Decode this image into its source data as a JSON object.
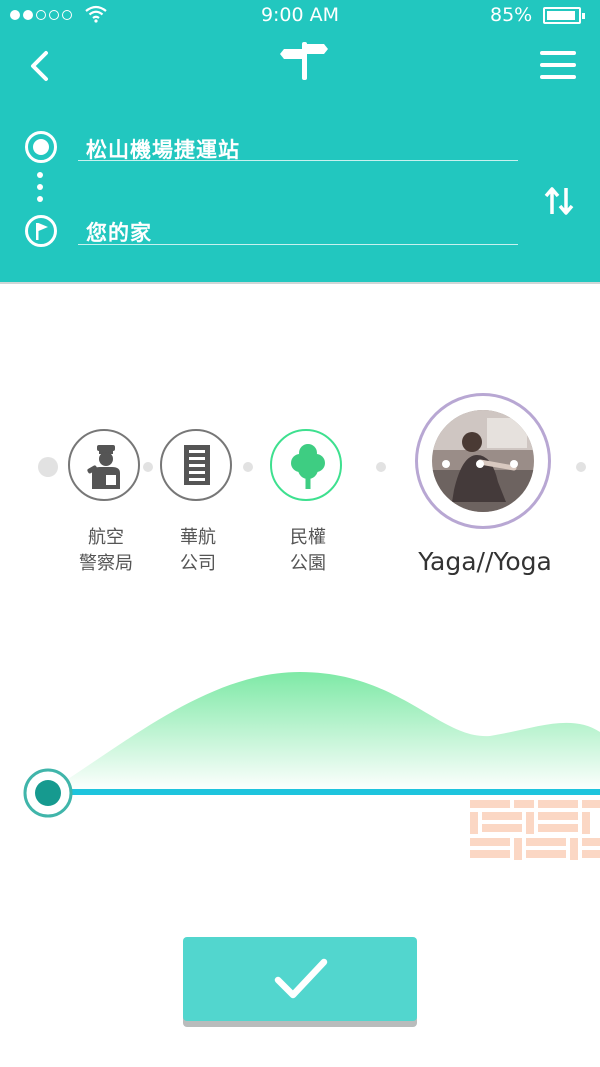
{
  "status_bar": {
    "time": "9:00  AM",
    "battery_percent": "85%",
    "signal_bars_filled": 2,
    "signal_bars_total": 5
  },
  "header": {
    "back_icon": "chevron-left-icon",
    "logo_icon": "signpost-icon",
    "menu_icon": "hamburger-icon",
    "origin": {
      "value": "松山機場捷運站",
      "icon": "origin-circle-icon"
    },
    "destination": {
      "value": "您的家",
      "icon": "flag-circle-icon"
    },
    "swap_icon": "swap-vertical-icon"
  },
  "route_stops": [
    {
      "label_line1": "航空",
      "label_line2": "警察局",
      "icon": "police-officer-icon"
    },
    {
      "label_line1": "華航",
      "label_line2": "公司",
      "icon": "office-building-icon"
    },
    {
      "label_line1": "民權",
      "label_line2": "公園",
      "icon": "tree-icon"
    }
  ],
  "featured_stop": {
    "title": "Yaga//Yoga",
    "image": "yoga-photo"
  },
  "colors": {
    "primary": "#22c7bf",
    "accent_green": "#3ee08f",
    "track": "#1ec4dd",
    "button": "#52d6ce"
  },
  "confirm_button": {
    "icon": "checkmark-icon"
  }
}
